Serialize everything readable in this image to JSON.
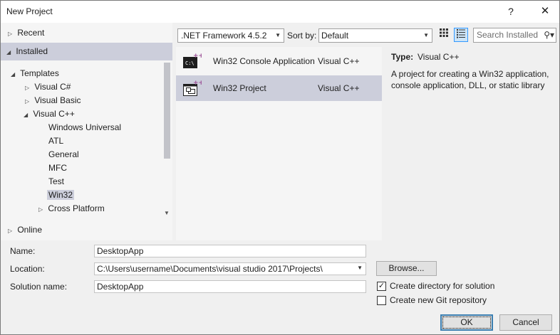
{
  "window": {
    "title": "New Project",
    "help_glyph": "?",
    "close_glyph": "✕"
  },
  "tree": {
    "recent": "Recent",
    "installed": "Installed",
    "templates": "Templates",
    "visual_csharp": "Visual C#",
    "visual_basic": "Visual Basic",
    "visual_cpp": "Visual C++",
    "cpp_children": [
      "Windows Universal",
      "ATL",
      "General",
      "MFC",
      "Test",
      "Win32",
      "Cross Platform"
    ],
    "online": "Online"
  },
  "toolbar": {
    "framework": ".NET Framework 4.5.2",
    "sort_label": "Sort by:",
    "sort_value": "Default",
    "search_placeholder": "Search Installed",
    "grid_icon": "grid-view-icon",
    "list_icon": "list-view-icon"
  },
  "templates": [
    {
      "name": "Win32 Console Application",
      "lang": "Visual C++",
      "icon": "console-app-icon",
      "selected": false
    },
    {
      "name": "Win32 Project",
      "lang": "Visual C++",
      "icon": "win32-project-icon",
      "selected": true
    }
  ],
  "details": {
    "type_label": "Type:",
    "type_value": "Visual C++",
    "description": "A project for creating a Win32 application, console application, DLL, or static library"
  },
  "form": {
    "name_label": "Name:",
    "name_value": "DesktopApp",
    "location_label": "Location:",
    "location_value": "C:\\Users\\username\\Documents\\visual studio 2017\\Projects\\",
    "solution_label": "Solution name:",
    "solution_value": "DesktopApp",
    "browse_label": "Browse...",
    "create_dir_label": "Create directory for solution",
    "create_dir_checked": true,
    "git_label": "Create new Git repository",
    "git_checked": false
  },
  "buttons": {
    "ok": "OK",
    "cancel": "Cancel"
  },
  "colors": {
    "selection": "#cccedb",
    "accent": "#3399ff",
    "cpp_badge": "#9b4f96"
  }
}
